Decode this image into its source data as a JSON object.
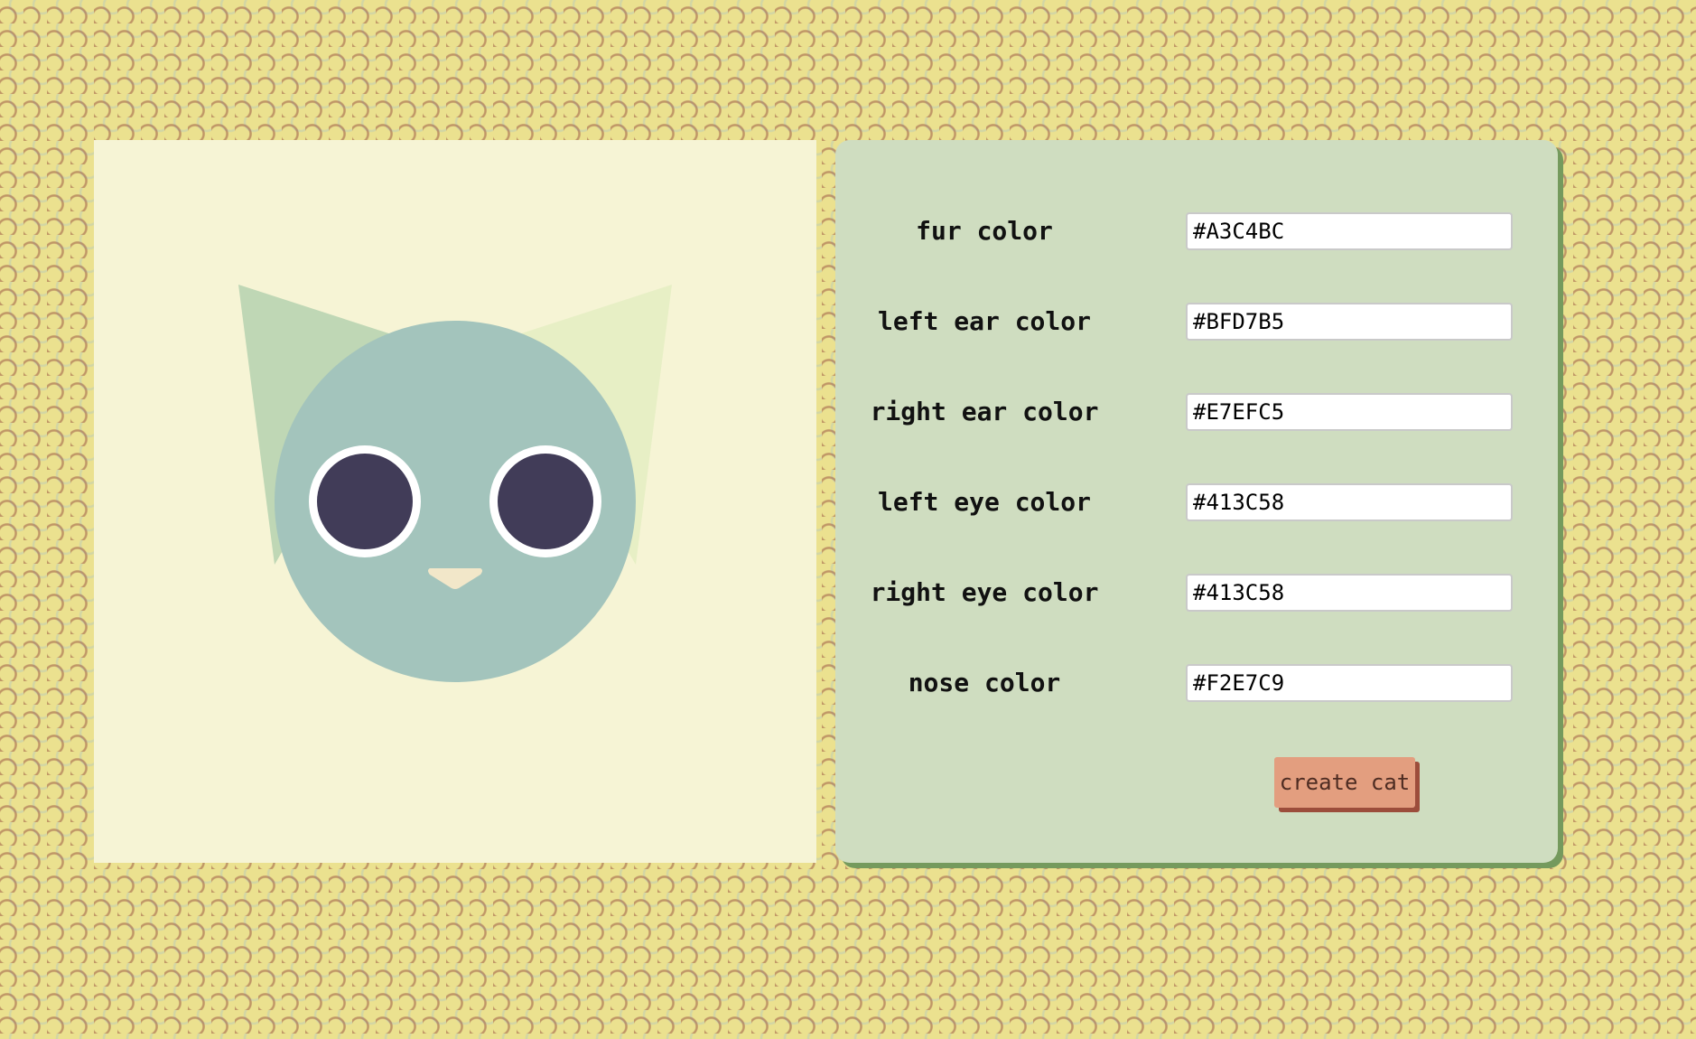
{
  "cat": {
    "fur_color": "#A3C4BC",
    "left_ear_color": "#BFD7B5",
    "right_ear_color": "#E7EFC5",
    "left_eye_color": "#413C58",
    "right_eye_color": "#413C58",
    "nose_color": "#F2E7C9",
    "eye_ring_color": "#FFFFFF"
  },
  "form": {
    "fields": [
      {
        "label": "fur color",
        "value": "#A3C4BC"
      },
      {
        "label": "left ear color",
        "value": "#BFD7B5"
      },
      {
        "label": "right ear color",
        "value": "#E7EFC5"
      },
      {
        "label": "left eye color",
        "value": "#413C58"
      },
      {
        "label": "right eye color",
        "value": "#413C58"
      },
      {
        "label": "nose color",
        "value": "#F2E7C9"
      }
    ],
    "submit_label": "create cat"
  },
  "colors": {
    "page_background": "#EBE18F",
    "canvas_background": "#F6F4D5",
    "form_background": "#CFDDC0",
    "form_shadow": "#759A5D",
    "button_background": "#E39E7F",
    "button_shadow": "#9C4D3B"
  }
}
